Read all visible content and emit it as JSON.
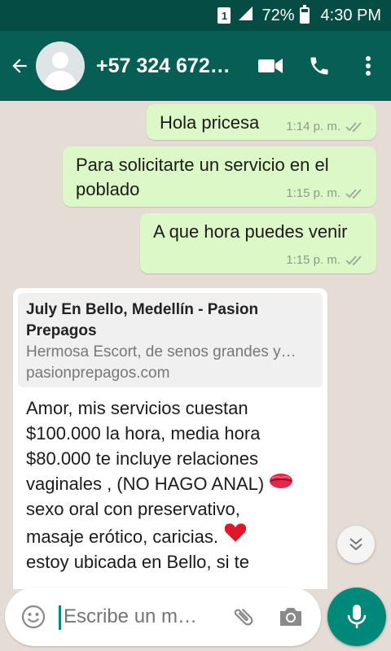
{
  "status_bar": {
    "sim": "1",
    "battery_percent": "72%",
    "time": "4:30 PM",
    "battery_level": 0.72
  },
  "header": {
    "contact": "+57 324 672…",
    "icons": [
      "back-arrow-icon",
      "avatar",
      "video-call-icon",
      "phone-icon",
      "more-vert-icon"
    ]
  },
  "messages": [
    {
      "direction": "outgoing",
      "text": "Hola pricesa",
      "time": "1:14 p. m.",
      "status": "read"
    },
    {
      "direction": "outgoing",
      "text": "Para solicitarte un servicio en el poblado",
      "time": "1:15 p. m.",
      "status": "read"
    },
    {
      "direction": "outgoing",
      "text": "A que hora puedes venir",
      "time": "1:15 p. m.",
      "status": "read"
    },
    {
      "direction": "incoming",
      "link_preview": {
        "title": "July En Bello, Medellín - Pasion Prepagos",
        "description": "Hermosa Escort, de senos grandes y…",
        "domain": "pasionprepagos.com"
      },
      "text_line1": "Amor, mis servicios cuestan",
      "text_line2": "$100.000 la hora, media hora",
      "text_line3": "$80.000 te incluye relaciones",
      "text_line4": "vaginales , (NO HAGO ANAL)",
      "text_line5": "sexo oral con preservativo,",
      "text_line6": "masaje erótico, caricias.",
      "text_line7": "estoy ubicada en Bello, si te"
    }
  ],
  "composer": {
    "placeholder": "Escribe un m…",
    "icons": [
      "emoji-icon",
      "attach-icon",
      "camera-icon",
      "mic-icon"
    ]
  },
  "colors": {
    "header": "#075e54",
    "status_bar": "#054d44",
    "outgoing_bubble": "#dcf8c6",
    "incoming_bubble": "#ffffff",
    "accent": "#00897b",
    "chat_background": "#e5ddd5"
  }
}
